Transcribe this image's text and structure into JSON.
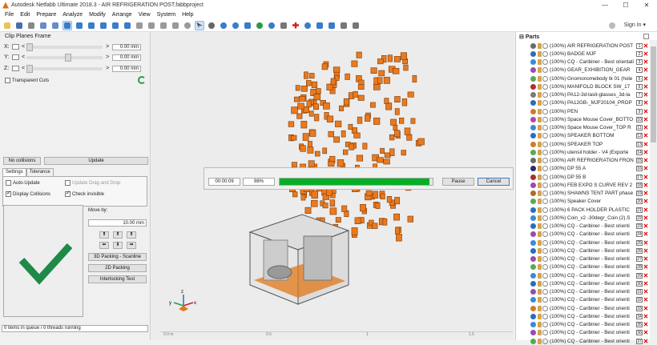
{
  "window": {
    "title": "Autodesk Netfabb Ultimate 2018.3 - AIR REFRIGERATION POST.fabbproject",
    "minimize": "—",
    "maximize": "☐",
    "close": "✕"
  },
  "menu": [
    "File",
    "Edit",
    "Prepare",
    "Analyze",
    "Modify",
    "Arrange",
    "View",
    "System",
    "Help"
  ],
  "toolbar": {
    "signin": "Sign In",
    "signin_arrow": "▾"
  },
  "clip_planes": {
    "title": "Clip Planes Frame",
    "axes": [
      {
        "label": "X:",
        "value": "0.00 mm"
      },
      {
        "label": "Y:",
        "value": "0.00 mm"
      },
      {
        "label": "Z:",
        "value": "0.00 mm"
      }
    ],
    "lt": "<",
    "gt": ">",
    "transparent_cuts": "Transparent Cuts"
  },
  "collision": {
    "status": "No collisions",
    "update": "Update",
    "tabs": [
      "Settings",
      "Tolerance"
    ],
    "auto_update": "Auto-Update",
    "update_drag": "Update Drag and Drop",
    "display_collisions": "Display Collisions",
    "check_invisible": "Check invisible"
  },
  "move": {
    "label": "Move by:",
    "value": "10.00 mm",
    "arrows": [
      "⬆",
      "⬆",
      "⬆",
      "⬅",
      "⬇",
      "➡"
    ],
    "buttons": [
      "3D Packing - Scanline",
      "2D Packing",
      "Interlocking Test"
    ]
  },
  "status": "0 items in queue / 0 threads running",
  "progress": {
    "time": "00:00:09",
    "percent_label": "98%",
    "percent": 0.98,
    "pause": "Pause",
    "cancel": "Cancel"
  },
  "axis_labels": {
    "x": "x",
    "y": "y",
    "z": "z"
  },
  "ruler": [
    "0.0 m",
    "0.5",
    "1",
    "1.5"
  ],
  "parts": {
    "title": "Parts",
    "items": [
      {
        "label": "(100%) AIR REFRIGERATION POST",
        "num": "1",
        "color": "#6a6a6a"
      },
      {
        "label": "(100%) BADGE MJF",
        "num": "2",
        "color": "#2a6cc0"
      },
      {
        "label": "(100%) CQ - Caribiner - Best orientati",
        "num": "3",
        "color": "#3a8ad8"
      },
      {
        "label": "(100%) GEAR_EXHIBITION_GEAR",
        "num": "4",
        "color": "#9a4ab0"
      },
      {
        "label": "(100%) Gnomonomebody tk 01 (hole",
        "num": "5",
        "color": "#58a858"
      },
      {
        "label": "(100%) MANIFOLD BLOCK SW_17",
        "num": "6",
        "color": "#b03030"
      },
      {
        "label": "(100%) PA12-3d-lasit-glasses_3d-la",
        "num": "7",
        "color": "#7a7a7a"
      },
      {
        "label": "(100%) PA12GB-_MJF20104_PROP",
        "num": "8",
        "color": "#2a6cc0"
      },
      {
        "label": "(100%) PEN",
        "num": "9",
        "color": "#d07a2a"
      },
      {
        "label": "(100%) Space Mouse Cover_BOTTO",
        "num": "10",
        "color": "#a84aa8"
      },
      {
        "label": "(100%) Space Mouse Cover_TOP R",
        "num": "11",
        "color": "#3a8ad8"
      },
      {
        "label": "(100%) SPEAKER BOTTOM",
        "num": "12",
        "color": "#2a6cc0"
      },
      {
        "label": "(100%) SPEAKER TOP",
        "num": "13",
        "color": "#d07a2a"
      },
      {
        "label": "(100%) utensil holder - V4 (Exporte",
        "num": "14",
        "color": "#58a858"
      },
      {
        "label": "(100%) AIR REFRIGERATION FRON",
        "num": "15",
        "color": "#6a6a6a"
      },
      {
        "label": "(100%) DP 55 A",
        "num": "16",
        "color": "#2a2a6a"
      },
      {
        "label": "(100%) DP 55 B",
        "num": "17",
        "color": "#a83030"
      },
      {
        "label": "(100%) FEB EXPO S CURVE REV 2",
        "num": "18",
        "color": "#9a4ab0"
      },
      {
        "label": "(100%) SHAWNS TENT PART phase",
        "num": "19",
        "color": "#b06a2a"
      },
      {
        "label": "(100%) Speaker Cover",
        "num": "20",
        "color": "#58a858"
      },
      {
        "label": "(100%) 6 PACK HOLDER PLASTIC",
        "num": "21",
        "color": "#2a6cc0"
      },
      {
        "label": "(100%) Coin_v2 -30degr_Coin (2).S",
        "num": "22",
        "color": "#3a8ad8"
      },
      {
        "label": "(100%) CQ - Caribiner - Best orienti",
        "num": "23",
        "color": "#2a6cc0"
      },
      {
        "label": "(100%) CQ - Caribiner - Best orienti",
        "num": "24",
        "color": "#9a4ab0"
      },
      {
        "label": "(100%) CQ - Caribiner - Best orienti",
        "num": "25",
        "color": "#3a8ad8"
      },
      {
        "label": "(100%) CQ - Caribiner - Best orienti",
        "num": "26",
        "color": "#2a6cc0"
      },
      {
        "label": "(100%) CQ - Caribiner - Best orienti",
        "num": "27",
        "color": "#9a4ab0"
      },
      {
        "label": "(100%) CQ - Caribiner - Best orienti",
        "num": "28",
        "color": "#58a858"
      },
      {
        "label": "(100%) CQ - Caribiner - Best orienti",
        "num": "29",
        "color": "#3a8ad8"
      },
      {
        "label": "(100%) CQ - Caribiner - Best orienti",
        "num": "30",
        "color": "#2a6cc0"
      },
      {
        "label": "(100%) CQ - Caribiner - Best orienti",
        "num": "31",
        "color": "#9a4ab0"
      },
      {
        "label": "(100%) CQ - Caribiner - Best orienti",
        "num": "32",
        "color": "#3a8ad8"
      },
      {
        "label": "(100%) CQ - Caribiner - Best orienti",
        "num": "33",
        "color": "#d07a2a"
      },
      {
        "label": "(100%) CQ - Caribiner - Best orienti",
        "num": "34",
        "color": "#2a6cc0"
      },
      {
        "label": "(100%) CQ - Caribiner - Best orienti",
        "num": "35",
        "color": "#3a8ad8"
      },
      {
        "label": "(100%) CQ - Caribiner - Best orienti",
        "num": "36",
        "color": "#9a4ab0"
      },
      {
        "label": "(100%) CQ - Caribiner - Best orienti",
        "num": "37",
        "color": "#58a858"
      }
    ]
  },
  "colors": {
    "accent_green": "#06b025",
    "checkmark": "#1f8a48",
    "part_orange": "#ea7a1e",
    "delete_red": "#dd0000"
  },
  "icons": [
    "app-icon",
    "open-icon",
    "save-icon",
    "print-icon",
    "undo-icon",
    "select-icon",
    "rotate-icon",
    "zoom-icon",
    "repair-icon",
    "add-icon",
    "support-icon",
    "settings-icon",
    "cloud-icon"
  ]
}
